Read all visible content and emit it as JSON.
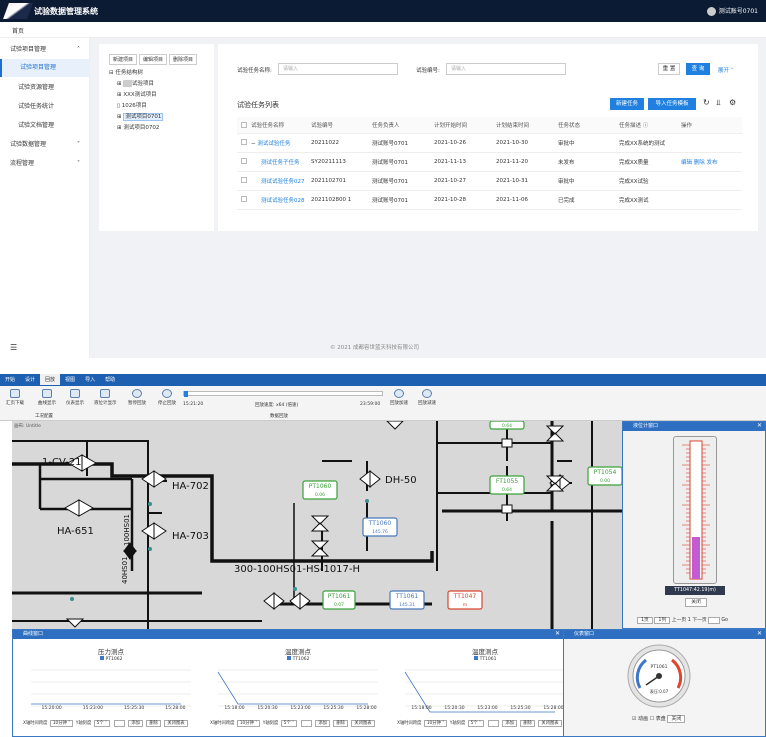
{
  "app": {
    "title": "试验数据管理系统",
    "user": "测试账号0701",
    "home": "首页"
  },
  "sidebar": {
    "items": [
      {
        "label": "试验项目管理",
        "arrow": "˄"
      },
      {
        "label": "试验项目管理"
      },
      {
        "label": "试验资源管理"
      },
      {
        "label": "试验任务统计"
      },
      {
        "label": "试验文档管理"
      },
      {
        "label": "试验数据管理",
        "arrow": "˅"
      },
      {
        "label": "流程管理",
        "arrow": "˅"
      }
    ],
    "collapse": "☰"
  },
  "tree": {
    "buttons": [
      "新建项目",
      "编辑项目",
      "删除项目"
    ],
    "nodes": [
      "任务结构树",
      "试验项目",
      "XXX测试项目",
      "1026项目",
      "测试项目0701",
      "测试项目0702"
    ]
  },
  "search": {
    "name_label": "试验任务名称:",
    "name_placeholder": "请输入",
    "code_label": "试验编号:",
    "code_placeholder": "请输入",
    "reset": "重 置",
    "query": "查 询",
    "expand": "展开 ˅"
  },
  "list": {
    "title": "试验任务列表",
    "new_btn": "新建任务",
    "import_btn": "导入任务模板",
    "columns": [
      "试验任务名称",
      "试验编号",
      "任务负责人",
      "计划开始时间",
      "计划结束时间",
      "任务状态",
      "任务描述 ⓘ",
      "操作"
    ],
    "rows": [
      {
        "prefix": "−",
        "name": "测试试验任务",
        "code": "20211022",
        "owner": "测试账号0701",
        "start": "2021-10-26",
        "end": "2021-10-30",
        "status": "审批中",
        "desc": "完成XX系统的测试",
        "ops": ""
      },
      {
        "prefix": "",
        "name": "测试任务子任务",
        "code": "SY20211113",
        "owner": "测试账号0701",
        "start": "2021-11-13",
        "end": "2021-11-20",
        "status": "未发布",
        "desc": "完成XX质量",
        "ops": "编辑  删除  发布"
      },
      {
        "prefix": "",
        "name": "测试试验任务027",
        "code": "2021102701",
        "owner": "测试账号0701",
        "start": "2021-10-27",
        "end": "2021-10-31",
        "status": "审批中",
        "desc": "完成XX试验",
        "ops": ""
      },
      {
        "prefix": "",
        "name": "测试试验任务028",
        "code": "2021102800 1",
        "owner": "测试账号0701",
        "start": "2021-10-28",
        "end": "2021-11-06",
        "status": "已完成",
        "desc": "完成XX测试",
        "ops": ""
      }
    ]
  },
  "footer": "© 2021 成都容世蓝天科技有限公司",
  "scada": {
    "menu": [
      "开始",
      "设计",
      "回放",
      "视图",
      "导入",
      "帮助"
    ],
    "ribbon": {
      "items": [
        "汇页下载",
        "曲线显示",
        "仪表显示",
        "液位计显示",
        "暂停回放",
        "停止回放"
      ],
      "time_start": "15:21:20",
      "speed_label": "回放速度: x64 (倍速)",
      "time_end": "23:59:00",
      "speed_up": "回放加速",
      "slow_down": "回放减速",
      "group1": "工况配置",
      "group2": "数据回放"
    },
    "canvas_title": "画布: Untitle",
    "tags": {
      "cv21": "1-CV-21",
      "ha651": "HA-651",
      "ha702": "HA-702",
      "ha703": "HA-703",
      "pipe1": "100HS01",
      "pipe2": "40HS01",
      "dh50": "DH-50",
      "line": "300-100HS01-HS-1017-H"
    },
    "instruments": [
      {
        "name": "PT1060",
        "value": "0.06",
        "color": "#3aa13a"
      },
      {
        "name": "TT1060",
        "value": "145.76",
        "color": "#4a78b8"
      },
      {
        "name": "FT1055",
        "value": "0.64",
        "color": "#3aa13a"
      },
      {
        "name": "PT1054",
        "value": "0.00",
        "color": "#3aa13a"
      },
      {
        "name": "PT1061",
        "value": "0.07",
        "color": "#3aa13a"
      },
      {
        "name": "TT1061",
        "value": "145.31",
        "color": "#4a78b8"
      },
      {
        "name": "TT1047",
        "value": "m",
        "color": "#d9442f"
      },
      {
        "name": "",
        "value": "0.64",
        "color": "#3aa13a"
      }
    ],
    "level_window": {
      "title": "液位计窗口",
      "readout": "TT1047:42.19(m)",
      "close": "关闭",
      "pager": {
        "page_select": "1页",
        "per_select": "1列",
        "prev": "上一页",
        "page": "1",
        "next": "下一页",
        "go": "Go"
      }
    },
    "curve_window": {
      "title": "曲线窗口",
      "charts": [
        {
          "title": "压力测点",
          "legend": "PT1062",
          "ticks": [
            "15:20:00",
            "15:23:00",
            "15:25:30",
            "15:28:00"
          ],
          "x_span": "10分钟",
          "y_span": "5个"
        },
        {
          "title": "温度测点",
          "legend": "TT1062",
          "ticks": [
            "15:18:00",
            "15:20:30",
            "15:23:00",
            "15:25:30",
            "15:28:00"
          ],
          "x_span": "10分钟",
          "y_span": "5个"
        },
        {
          "title": "温度测点",
          "legend": "TT1061",
          "ticks": [
            "15:18:00",
            "15:20:30",
            "15:23:00",
            "15:25:30",
            "15:28:00"
          ],
          "x_span": "10分钟",
          "y_span": "5个"
        }
      ],
      "controls": {
        "x_label": "X轴时间跨度",
        "y_label": "Y轴刻度",
        "add": "添加",
        "del": "删除",
        "close_chart": "关闭图表"
      }
    },
    "gauge_window": {
      "title": "仪表窗口",
      "tag": "PT1061",
      "value": "0.07",
      "unit": "表压:0.07",
      "opt1": "动画",
      "opt2": "表盘",
      "close": "关闭"
    }
  }
}
